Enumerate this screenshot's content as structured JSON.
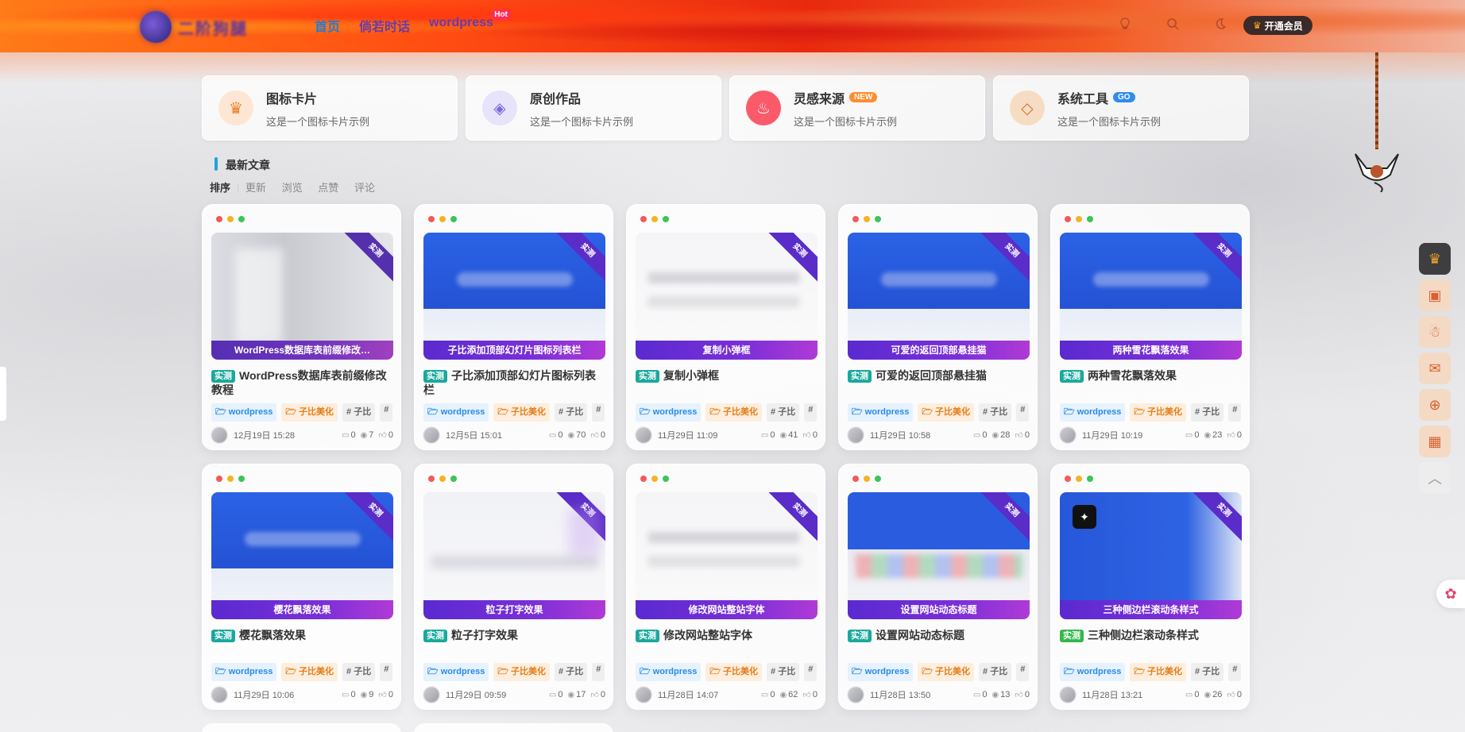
{
  "header": {
    "logo_text": "二阶狗腿",
    "nav": [
      {
        "label": "首页",
        "active": true
      },
      {
        "label": "倘若时话",
        "active": false
      },
      {
        "label": "wordpress",
        "active": false,
        "badge": "Hot"
      }
    ],
    "icons": [
      "lightbulb-icon",
      "search-icon",
      "moon-icon"
    ],
    "vip_label": "开通会员"
  },
  "icon_cards": [
    {
      "title": "图标卡片",
      "desc": "这是一个图标卡片示例",
      "icon": "crown-icon",
      "badge": ""
    },
    {
      "title": "原创作品",
      "desc": "这是一个图标卡片示例",
      "icon": "gem-icon",
      "badge": ""
    },
    {
      "title": "灵感来源",
      "desc": "这是一个图标卡片示例",
      "icon": "flame-icon",
      "badge": "NEW"
    },
    {
      "title": "系统工具",
      "desc": "这是一个图标卡片示例",
      "icon": "diamond-icon",
      "badge": "GO"
    }
  ],
  "section": {
    "title": "最新文章",
    "sort": [
      "排序",
      "更新",
      "浏览",
      "点赞",
      "评论"
    ]
  },
  "posts": [
    {
      "ribbon": "实测",
      "caption": "WordPress数据库表前缀修改…",
      "badge": "实测",
      "title": "WordPress数据库表前缀修改教程",
      "tags": [
        "wordpress",
        "子比美化",
        "子比"
      ],
      "date": "12月19日 15:28",
      "comments": "0",
      "views": "7",
      "likes": "0",
      "thumb": "gray"
    },
    {
      "ribbon": "实测",
      "caption": "子比添加顶部幻灯片图标列表栏",
      "badge": "实测",
      "title": "子比添加顶部幻灯片图标列表栏",
      "tags": [
        "wordpress",
        "子比美化",
        "子比"
      ],
      "date": "12月5日 15:01",
      "comments": "0",
      "views": "70",
      "likes": "0",
      "thumb": "blue"
    },
    {
      "ribbon": "实测",
      "caption": "复制小弹框",
      "badge": "实测",
      "title": "复制小弹框",
      "tags": [
        "wordpress",
        "子比美化",
        "子比"
      ],
      "date": "11月29日 11:09",
      "comments": "0",
      "views": "41",
      "likes": "0",
      "thumb": "white"
    },
    {
      "ribbon": "实测",
      "caption": "可爱的返回顶部悬挂猫",
      "badge": "实测",
      "title": "可爱的返回顶部悬挂猫",
      "tags": [
        "wordpress",
        "子比美化",
        "子比"
      ],
      "date": "11月29日 10:58",
      "comments": "0",
      "views": "28",
      "likes": "0",
      "thumb": "blue"
    },
    {
      "ribbon": "实测",
      "caption": "两种雪花飘落效果",
      "badge": "实测",
      "title": "两种雪花飘落效果",
      "tags": [
        "wordpress",
        "子比美化",
        "子比"
      ],
      "date": "11月29日 10:19",
      "comments": "0",
      "views": "23",
      "likes": "0",
      "thumb": "blue"
    },
    {
      "ribbon": "实测",
      "caption": "樱花飘落效果",
      "badge": "实测",
      "title": "樱花飘落效果",
      "tags": [
        "wordpress",
        "子比美化",
        "子比"
      ],
      "date": "11月29日 10:06",
      "comments": "0",
      "views": "9",
      "likes": "0",
      "thumb": "blue"
    },
    {
      "ribbon": "实测",
      "caption": "粒子打字效果",
      "badge": "实测",
      "title": "粒子打字效果",
      "tags": [
        "wordpress",
        "子比美化",
        "子比"
      ],
      "date": "11月29日 09:59",
      "comments": "0",
      "views": "17",
      "likes": "0",
      "thumb": "light"
    },
    {
      "ribbon": "实测",
      "caption": "修改网站整站字体",
      "badge": "实测",
      "title": "修改网站整站字体",
      "tags": [
        "wordpress",
        "子比美化",
        "子比"
      ],
      "date": "11月28日 14:07",
      "comments": "0",
      "views": "62",
      "likes": "0",
      "thumb": "white"
    },
    {
      "ribbon": "实测",
      "caption": "设置网站动态标题",
      "badge": "实测",
      "title": "设置网站动态标题",
      "tags": [
        "wordpress",
        "子比美化",
        "子比"
      ],
      "date": "11月28日 13:50",
      "comments": "0",
      "views": "13",
      "likes": "0",
      "thumb": "mixed"
    },
    {
      "ribbon": "实测",
      "caption": "三种侧边栏滚动条样式",
      "badge": "实测",
      "title": "三种侧边栏滚动条样式",
      "tags": [
        "wordpress",
        "子比美化",
        "子比"
      ],
      "date": "11月28日 13:21",
      "comments": "0",
      "views": "26",
      "likes": "0",
      "thumb": "side"
    }
  ],
  "float_bar": [
    "crown-icon",
    "gift-icon",
    "qq-icon",
    "wechat-icon",
    "plus-circle-icon",
    "qrcode-icon",
    "chevron-up-icon"
  ]
}
